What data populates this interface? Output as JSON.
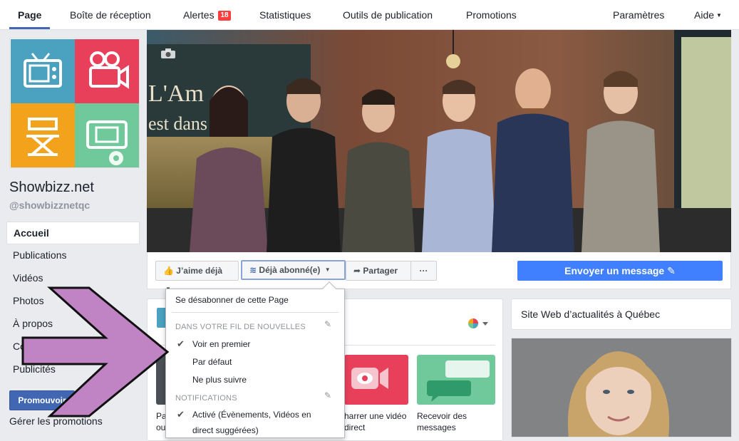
{
  "topnav": {
    "items": [
      {
        "label": "Page"
      },
      {
        "label": "Boîte de réception"
      },
      {
        "label": "Alertes",
        "badge": "18"
      },
      {
        "label": "Statistiques"
      },
      {
        "label": "Outils de publication"
      },
      {
        "label": "Promotions"
      },
      {
        "label": "Paramètres"
      },
      {
        "label": "Aide"
      }
    ]
  },
  "page": {
    "name": "Showbizz.net",
    "handle": "@showbizznetqc"
  },
  "left_nav": {
    "items": [
      {
        "label": "Accueil"
      },
      {
        "label": "Publications"
      },
      {
        "label": "Vidéos"
      },
      {
        "label": "Photos"
      },
      {
        "label": "À propos"
      },
      {
        "label": "Co"
      },
      {
        "label": "Publicités"
      }
    ],
    "promote_label": "Promouvoir",
    "manage_label": "Gérer les promotions"
  },
  "cover": {
    "wall_text_1": "L'Am",
    "wall_text_2": "est dans"
  },
  "actions": {
    "like_label": "J’aime déjà",
    "follow_label": "Déjà abonné(e)",
    "share_label": "Partager",
    "more_label": "···",
    "send_message_label": "Envoyer un message"
  },
  "dropdown": {
    "unfollow": "Se désabonner de cette Page",
    "feed_header": "DANS VOTRE FIL DE NOUVELLES",
    "see_first": "Voir en premier",
    "default": "Par défaut",
    "unfollow_feed": "Ne plus suivre",
    "notif_header": "NOTIFICATIONS",
    "notif_on_1": "Activé (Évènements, Vidéos en",
    "notif_on_2": "direct suggérées)"
  },
  "main_card": {
    "tile_left_1": "Pa",
    "tile_left_2": "ou",
    "tile_video_1": "harrer une vidéo",
    "tile_video_2": "direct",
    "tile_msg_1": "Recevoir des",
    "tile_msg_2": "messages"
  },
  "right_card": {
    "title": "Site Web d’actualités à Québec"
  },
  "colors": {
    "accent": "#4267b2",
    "send_button": "#4080ff",
    "arrow": "#c084c4",
    "tile_blue": "#4ba2c0",
    "tile_red": "#e8405b",
    "tile_orange": "#f3a21b",
    "tile_green": "#6fc99a"
  }
}
